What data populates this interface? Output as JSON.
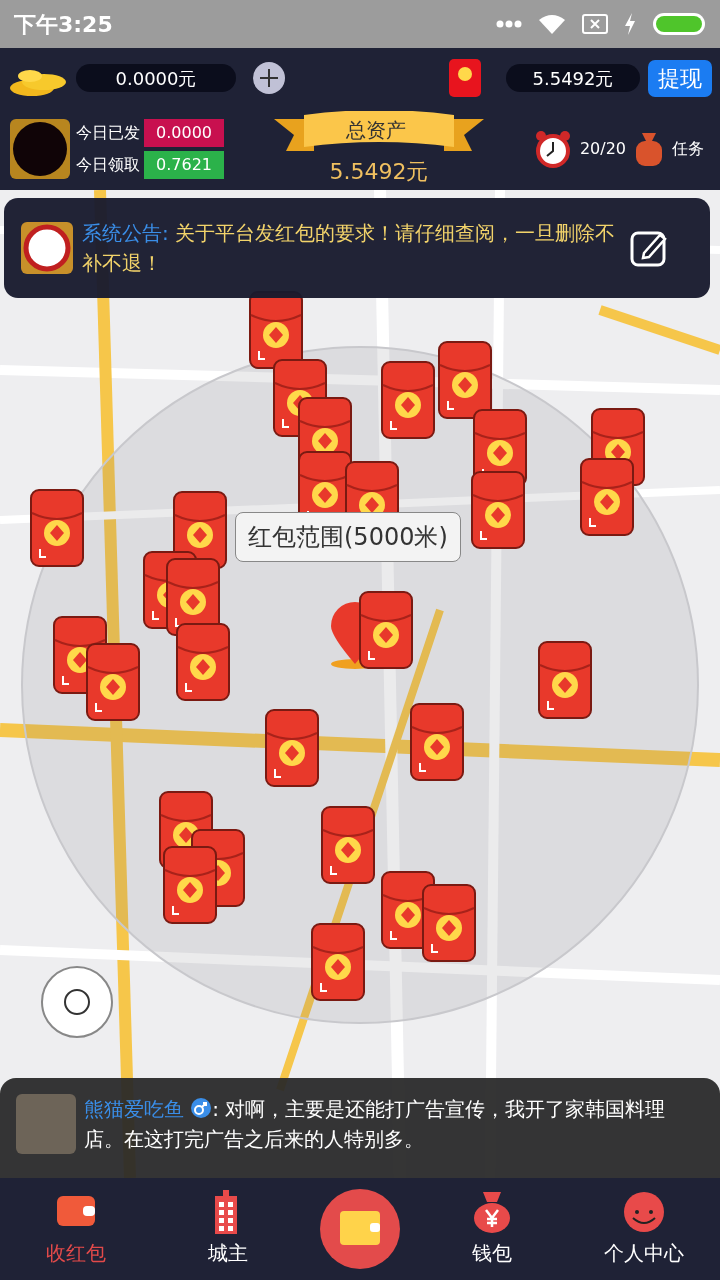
{
  "status_bar": {
    "time": "下午3:25"
  },
  "header": {
    "coins": "0.0000元",
    "balance": "5.5492元",
    "withdraw_button": "提现",
    "today_sent_label": "今日已发",
    "today_sent": "0.0000",
    "today_received_label": "今日领取",
    "today_received": "0.7621",
    "total_assets_label": "总资产",
    "total_assets": "5.5492元",
    "timer_count": "20/20",
    "tasks_label": "任务"
  },
  "notice": {
    "label": "系统公告:",
    "text": "关于平台发红包的要求！请仔细查阅，一旦删除不补不退！"
  },
  "map": {
    "range_tooltip": "红包范围(5000米)"
  },
  "chat": {
    "user": "熊猫爱吃鱼",
    "message": ": 对啊，主要是还能打广告宣传，我开了家韩国料理店。在这打完广告之后来的人特别多。"
  },
  "nav": [
    {
      "kind": "wallet",
      "label": "收红包",
      "selected": true
    },
    {
      "kind": "building",
      "label": "城主",
      "selected": false
    },
    {
      "kind": "center",
      "selected": false
    },
    {
      "kind": "moneybag",
      "label": "钱包",
      "selected": false
    },
    {
      "kind": "face",
      "label": "个人中心",
      "selected": false
    }
  ]
}
